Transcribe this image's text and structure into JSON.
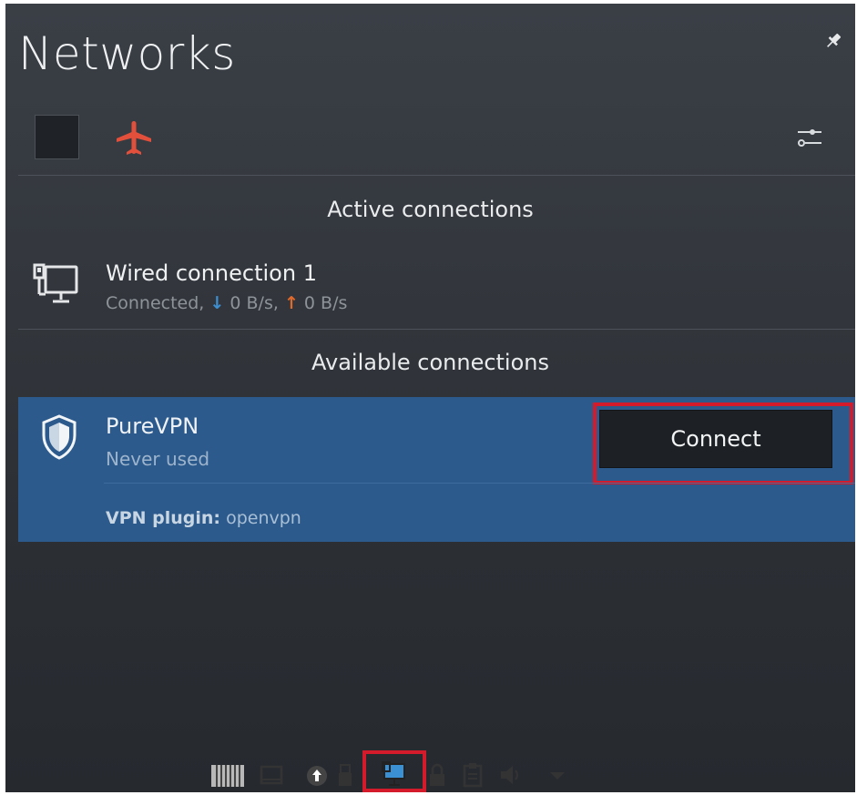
{
  "header": {
    "title": "Networks"
  },
  "sections": {
    "active_label": "Active connections",
    "available_label": "Available connections"
  },
  "active_connection": {
    "name": "Wired connection 1",
    "status_prefix": "Connected,",
    "download_rate": "0 B/s,",
    "upload_rate": "0 B/s"
  },
  "available_connection": {
    "name": "PureVPN",
    "status": "Never used",
    "plugin_label": "VPN plugin:",
    "plugin_value": "openvpn",
    "connect_label": "Connect"
  },
  "colors": {
    "airplane": "#e2503c",
    "highlight": "#d41b2c",
    "selected_row": "#2c5a8c",
    "download_arrow": "#3d8fd0",
    "upload_arrow": "#e06a2c"
  },
  "icons": {
    "pin": "pin-icon",
    "airplane": "airplane-mode-icon",
    "settings": "network-settings-icon",
    "wired": "wired-network-icon",
    "vpn": "vpn-shield-icon",
    "tray": [
      "keyboard-layout-icon",
      "display-icon",
      "updates-icon",
      "usb-device-icon",
      "network-icon",
      "lock-icon",
      "clipboard-icon",
      "volume-icon",
      "expand-tray-icon"
    ]
  }
}
